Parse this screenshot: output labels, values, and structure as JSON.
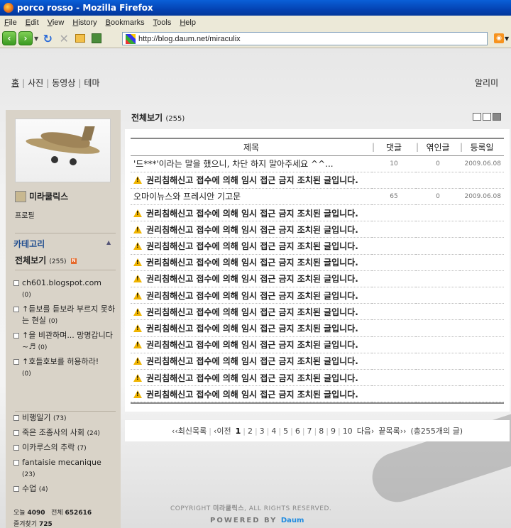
{
  "window": {
    "title": "porco rosso - Mozilla Firefox"
  },
  "menu": [
    "File",
    "Edit",
    "View",
    "History",
    "Bookmarks",
    "Tools",
    "Help"
  ],
  "url": "http://blog.daum.net/miraculix",
  "topnav": {
    "items": [
      "홈",
      "사진",
      "동영상",
      "테마"
    ],
    "right": "알리미"
  },
  "sidebar": {
    "nickname": "미라쿨릭스",
    "profile_label": "프로필",
    "category_title": "카테고리",
    "all_label": "전체보기",
    "all_count": "(255)",
    "new_badge": "N",
    "group1": [
      {
        "label": "ch601.blogspot.com",
        "count": "(0)"
      },
      {
        "label": "↑듣보를 듣보라 부르지 못하는 현실",
        "count": "(0)"
      },
      {
        "label": "↑을 비관하며... 망명갑니다~♬",
        "count": "(0)"
      },
      {
        "label": "↑호들호보를 허용하라!",
        "count": "(0)"
      }
    ],
    "group2": [
      {
        "label": "비행일기",
        "count": "(73)"
      },
      {
        "label": "죽은 조종사의 사회",
        "count": "(24)"
      },
      {
        "label": "이카루스의 추락",
        "count": "(7)"
      },
      {
        "label": "fantaisie mecanique",
        "count": "(23)"
      },
      {
        "label": "수업",
        "count": "(4)"
      }
    ],
    "stats": {
      "today_label": "오늘",
      "today": "4090",
      "total_label": "전체",
      "total": "652616",
      "fav_label": "즐겨찾기",
      "fav": "725"
    }
  },
  "main": {
    "title": "전체보기",
    "count": "(255)",
    "headers": [
      "제목",
      "댓글",
      "엮인글",
      "등록일"
    ],
    "rows": [
      {
        "title": "'드***'이라는 말을 했으니, 차단 하지 말아주세요 ^^...",
        "comments": "10",
        "trackbacks": "0",
        "date": "2009.06.08"
      },
      {
        "blocked": "권리침해신고 접수에 의해 임시 접근 금지 조치된 글입니다."
      },
      {
        "title": "오마이뉴스와 프레시안 기고문",
        "comments": "65",
        "trackbacks": "0",
        "date": "2009.06.08"
      },
      {
        "blocked": "권리침해신고 접수에 의해 임시 접근 금지 조치된 글입니다."
      },
      {
        "blocked": "권리침해신고 접수에 의해 임시 접근 금지 조치된 글입니다."
      },
      {
        "blocked": "권리침해신고 접수에 의해 임시 접근 금지 조치된 글입니다."
      },
      {
        "blocked": "권리침해신고 접수에 의해 임시 접근 금지 조치된 글입니다."
      },
      {
        "blocked": "권리침해신고 접수에 의해 임시 접근 금지 조치된 글입니다."
      },
      {
        "blocked": "권리침해신고 접수에 의해 임시 접근 금지 조치된 글입니다."
      },
      {
        "blocked": "권리침해신고 접수에 의해 임시 접근 금지 조치된 글입니다."
      },
      {
        "blocked": "권리침해신고 접수에 의해 임시 접근 금지 조치된 글입니다."
      },
      {
        "blocked": "권리침해신고 접수에 의해 임시 접근 금지 조치된 글입니다."
      },
      {
        "blocked": "권리침해신고 접수에 의해 임시 접근 금지 조치된 글입니다."
      },
      {
        "blocked": "권리침해신고 접수에 의해 임시 접근 금지 조치된 글입니다."
      },
      {
        "blocked": "권리침해신고 접수에 의해 임시 접근 금지 조치된 글입니다."
      }
    ]
  },
  "pager": {
    "first": "‹‹최신목록",
    "prev": "‹이전",
    "pages": [
      "1",
      "2",
      "3",
      "4",
      "5",
      "6",
      "7",
      "8",
      "9",
      "10"
    ],
    "current": "1",
    "next": "다음›",
    "last": "끝목록››",
    "total": "(총255개의 글)"
  },
  "footer": {
    "copyright_prefix": "COPYRIGHT",
    "owner": "미라쿨릭스",
    "copyright_suffix": ", ALL RIGHTS RESERVED.",
    "powered": "POWERED BY",
    "brand": "Daum"
  }
}
